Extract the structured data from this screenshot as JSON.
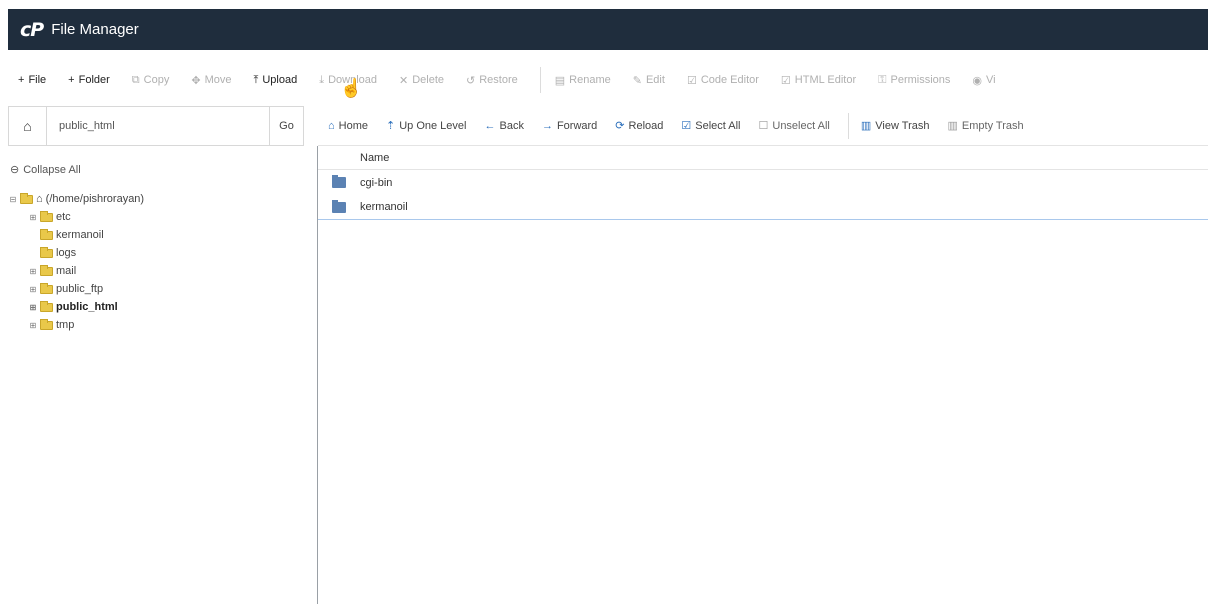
{
  "app": {
    "logo": "cP",
    "title": "File Manager"
  },
  "toolbar": {
    "items": [
      {
        "icon": "+",
        "label": "File",
        "enabled": true
      },
      {
        "icon": "+",
        "label": "Folder",
        "enabled": true
      },
      {
        "icon": "⧉",
        "label": "Copy",
        "enabled": false
      },
      {
        "icon": "✥",
        "label": "Move",
        "enabled": false
      },
      {
        "icon": "⤒",
        "label": "Upload",
        "enabled": true
      },
      {
        "icon": "⤓",
        "label": "Download",
        "enabled": false
      },
      {
        "icon": "✕",
        "label": "Delete",
        "enabled": false
      },
      {
        "icon": "↺",
        "label": "Restore",
        "enabled": false
      },
      {
        "icon": "▤",
        "label": "Rename",
        "enabled": false
      },
      {
        "icon": "✎",
        "label": "Edit",
        "enabled": false
      },
      {
        "icon": "☑",
        "label": "Code Editor",
        "enabled": false
      },
      {
        "icon": "☑",
        "label": "HTML Editor",
        "enabled": false
      },
      {
        "icon": "⚿",
        "label": "Permissions",
        "enabled": false
      },
      {
        "icon": "◉",
        "label": "Vi",
        "enabled": false
      }
    ]
  },
  "path": {
    "value": "public_html",
    "go_label": "Go"
  },
  "nav": {
    "home": "Home",
    "up": "Up One Level",
    "back": "Back",
    "forward": "Forward",
    "reload": "Reload",
    "select_all": "Select All",
    "unselect_all": "Unselect All",
    "view_trash": "View Trash",
    "empty_trash": "Empty Trash"
  },
  "sidebar": {
    "collapse_label": "Collapse All",
    "root_label": "(/home/pishrorayan)",
    "folders": [
      {
        "label": "etc",
        "expandable": true,
        "active": false
      },
      {
        "label": "kermanoil",
        "expandable": false,
        "active": false
      },
      {
        "label": "logs",
        "expandable": false,
        "active": false
      },
      {
        "label": "mail",
        "expandable": true,
        "active": false
      },
      {
        "label": "public_ftp",
        "expandable": true,
        "active": false
      },
      {
        "label": "public_html",
        "expandable": true,
        "active": true
      },
      {
        "label": "tmp",
        "expandable": true,
        "active": false
      }
    ]
  },
  "files": {
    "header_name": "Name",
    "rows": [
      {
        "name": "cgi-bin"
      },
      {
        "name": "kermanoil"
      }
    ]
  }
}
